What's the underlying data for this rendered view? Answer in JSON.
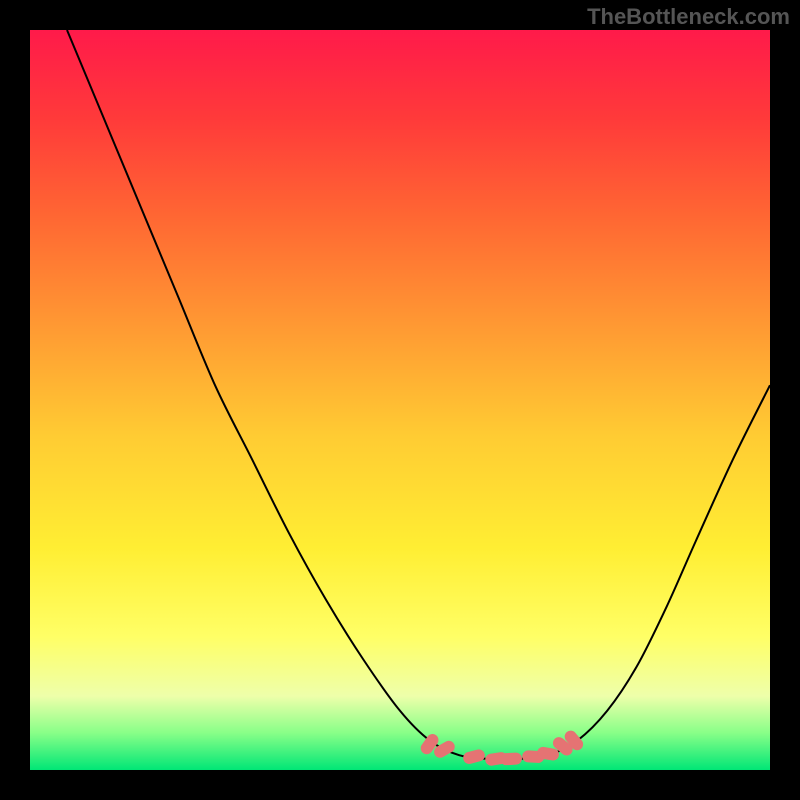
{
  "watermark": "TheBottleneck.com",
  "chart_data": {
    "type": "line",
    "title": "",
    "xlabel": "",
    "ylabel": "",
    "xlim": [
      0,
      100
    ],
    "ylim": [
      0,
      100
    ],
    "gradient_stops": [
      {
        "offset": 0.0,
        "color": "#ff1a4a"
      },
      {
        "offset": 0.12,
        "color": "#ff3a3a"
      },
      {
        "offset": 0.25,
        "color": "#ff6633"
      },
      {
        "offset": 0.4,
        "color": "#ff9933"
      },
      {
        "offset": 0.55,
        "color": "#ffcc33"
      },
      {
        "offset": 0.7,
        "color": "#ffee33"
      },
      {
        "offset": 0.82,
        "color": "#ffff66"
      },
      {
        "offset": 0.9,
        "color": "#eeffaa"
      },
      {
        "offset": 0.95,
        "color": "#88ff88"
      },
      {
        "offset": 1.0,
        "color": "#00e676"
      }
    ],
    "series": [
      {
        "name": "bottleneck-curve",
        "type": "line",
        "color": "#000000",
        "points": [
          {
            "x": 5,
            "y": 100
          },
          {
            "x": 10,
            "y": 88
          },
          {
            "x": 15,
            "y": 76
          },
          {
            "x": 20,
            "y": 64
          },
          {
            "x": 25,
            "y": 52
          },
          {
            "x": 30,
            "y": 42
          },
          {
            "x": 35,
            "y": 32
          },
          {
            "x": 40,
            "y": 23
          },
          {
            "x": 45,
            "y": 15
          },
          {
            "x": 50,
            "y": 8
          },
          {
            "x": 54,
            "y": 4
          },
          {
            "x": 58,
            "y": 2
          },
          {
            "x": 62,
            "y": 1.5
          },
          {
            "x": 66,
            "y": 1.5
          },
          {
            "x": 70,
            "y": 2
          },
          {
            "x": 74,
            "y": 4
          },
          {
            "x": 78,
            "y": 8
          },
          {
            "x": 82,
            "y": 14
          },
          {
            "x": 86,
            "y": 22
          },
          {
            "x": 90,
            "y": 31
          },
          {
            "x": 95,
            "y": 42
          },
          {
            "x": 100,
            "y": 52
          }
        ]
      }
    ],
    "highlight_markers": {
      "color": "#e57373",
      "points": [
        {
          "x": 54,
          "y": 3.5
        },
        {
          "x": 56,
          "y": 2.8
        },
        {
          "x": 60,
          "y": 1.8
        },
        {
          "x": 63,
          "y": 1.5
        },
        {
          "x": 65,
          "y": 1.5
        },
        {
          "x": 68,
          "y": 1.8
        },
        {
          "x": 70,
          "y": 2.2
        },
        {
          "x": 72,
          "y": 3.2
        },
        {
          "x": 73.5,
          "y": 4.0
        }
      ]
    }
  }
}
